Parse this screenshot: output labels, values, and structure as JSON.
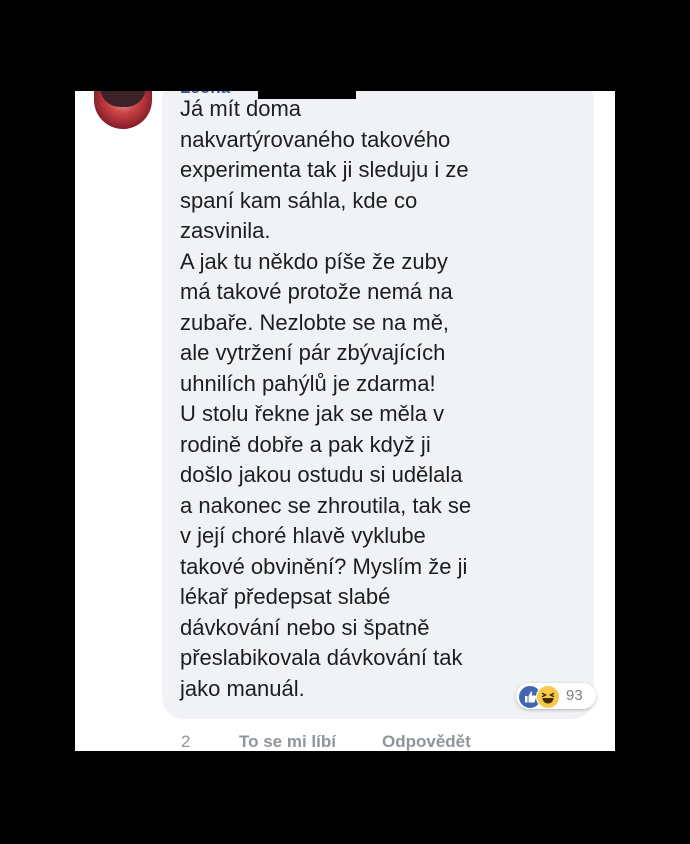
{
  "comment": {
    "author": "Leona",
    "lines": [
      "Já mít doma",
      "nakvartýrovaného takového",
      "experimenta tak ji sleduju i ze",
      "spaní kam sáhla, kde co",
      "zasvinila.",
      "A jak tu někdo píše že zuby",
      "má takové protože nemá na",
      "zubaře. Nezlobte se na mě,",
      "ale vytržení pár zbývajících",
      "uhnilích pahýlů je zdarma!",
      "U stolu řekne jak se měla v",
      "rodině dobře a pak když ji",
      "došlo jakou ostudu si udělala",
      "a nakonec se zhroutila, tak se",
      "v její choré hlavě vyklube",
      "takové obvinění? Myslím že ji",
      "lékař předepsat slabé",
      "dávkování nebo si špatně",
      "přeslabikovala dávkování tak",
      "jako manuál."
    ],
    "reactions": {
      "count": "93",
      "icons": [
        "like-icon",
        "haha-icon"
      ]
    },
    "time": "2 d",
    "like_label": "To se mi líbí",
    "reply_label": "Odpovědět"
  },
  "colors": {
    "link": "#365899",
    "bubble": "#f1f2f5",
    "text": "#1c1e21",
    "meta": "#90949c",
    "like": "#4267b2",
    "haha": "#f7c948"
  }
}
